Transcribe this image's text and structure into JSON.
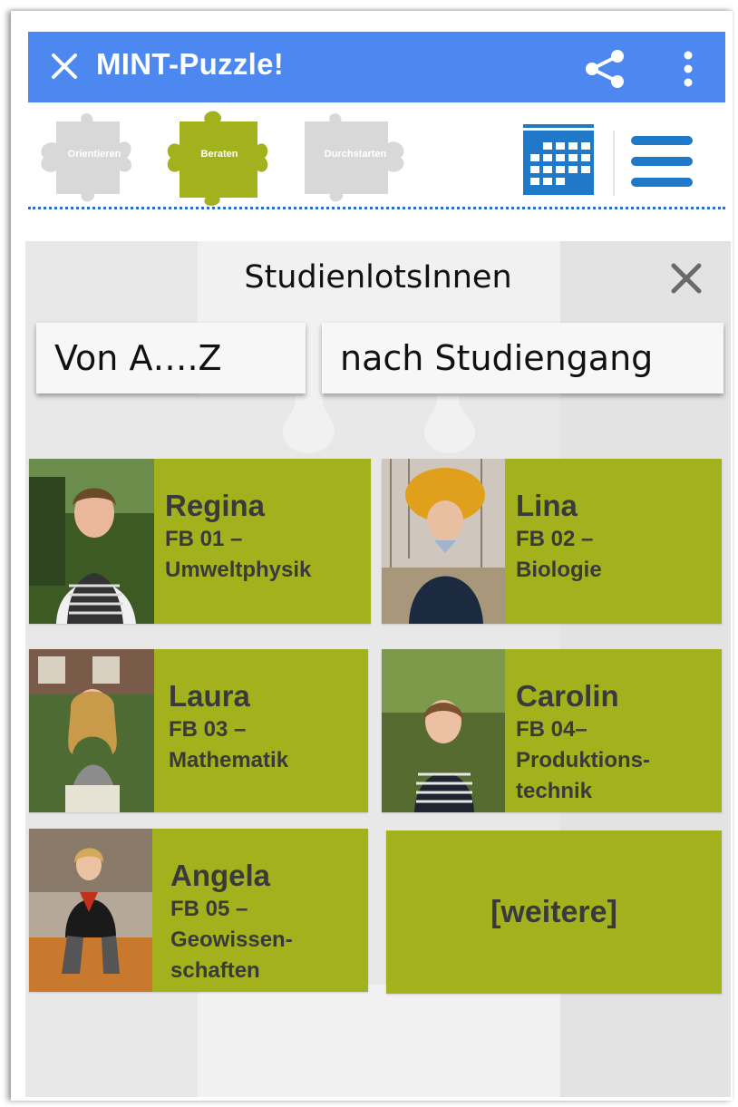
{
  "appbar": {
    "title": "MINT-Puzzle!",
    "color": "#4d87f0",
    "icons": [
      "close-icon",
      "share-icon",
      "more-vert-icon"
    ]
  },
  "nav": {
    "steps": [
      {
        "label": "Orientieren",
        "active": false
      },
      {
        "label": "Beraten",
        "active": true
      },
      {
        "label": "Durchstarten",
        "active": false
      }
    ],
    "active_color": "#a2b11c",
    "inactive_color": "#d8d8d8",
    "icons": [
      "calendar-icon",
      "hamburger-menu-icon"
    ]
  },
  "panel": {
    "title": "StudienlotsInnen",
    "sort_az": "Von A….Z",
    "sort_course": "nach Studiengang"
  },
  "people": [
    {
      "name": "Regina",
      "dept_line1": "FB 01 –",
      "dept_line2": "Umweltphysik",
      "dept_line3": ""
    },
    {
      "name": "Lina",
      "dept_line1": "FB 02 –",
      "dept_line2": "Biologie",
      "dept_line3": ""
    },
    {
      "name": "Laura",
      "dept_line1": "FB 03 –",
      "dept_line2": "Mathematik",
      "dept_line3": ""
    },
    {
      "name": "Carolin",
      "dept_line1": "FB 04–",
      "dept_line2": "Produktions-",
      "dept_line3": "technik"
    },
    {
      "name": "Angela",
      "dept_line1": "FB 05 –",
      "dept_line2": "Geowissen-",
      "dept_line3": "schaften"
    }
  ],
  "more_label": "[weitere]",
  "card_color": "#a2b11c"
}
